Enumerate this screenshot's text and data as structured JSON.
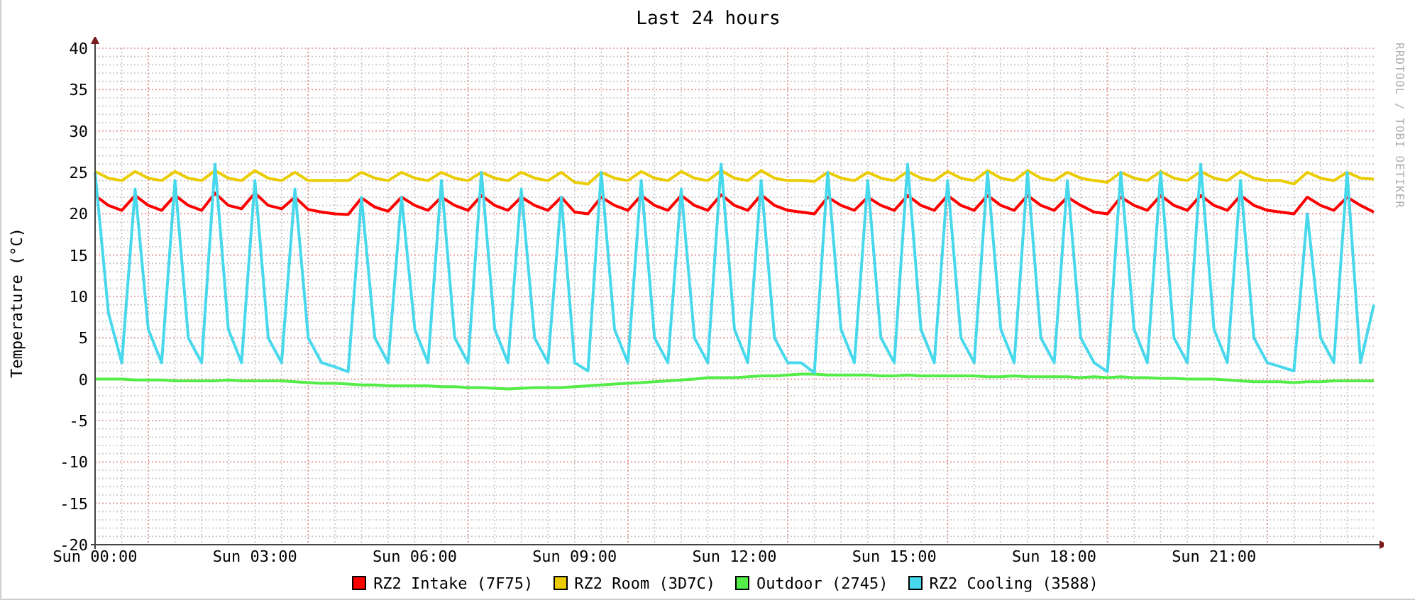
{
  "credit": "RRDTOOL / TOBI OETIKER",
  "chart_data": {
    "type": "line",
    "title": "Last 24 hours",
    "ylabel": "Temperature (°C)",
    "grid": true,
    "ylim": [
      -20,
      40
    ],
    "categories": [
      "Sun 00:00",
      null,
      null,
      null,
      null,
      null,
      null,
      null,
      null,
      null,
      null,
      null,
      "Sun 03:00",
      null,
      null,
      null,
      null,
      null,
      null,
      null,
      null,
      null,
      null,
      null,
      "Sun 06:00",
      null,
      null,
      null,
      null,
      null,
      null,
      null,
      null,
      null,
      null,
      null,
      "Sun 09:00",
      null,
      null,
      null,
      null,
      null,
      null,
      null,
      null,
      null,
      null,
      null,
      "Sun 12:00",
      null,
      null,
      null,
      null,
      null,
      null,
      null,
      null,
      null,
      null,
      null,
      "Sun 15:00",
      null,
      null,
      null,
      null,
      null,
      null,
      null,
      null,
      null,
      null,
      null,
      "Sun 18:00",
      null,
      null,
      null,
      null,
      null,
      null,
      null,
      null,
      null,
      null,
      null,
      "Sun 21:00",
      null,
      null,
      null,
      null,
      null,
      null,
      null,
      null,
      null,
      null,
      null,
      null
    ],
    "yticks": [
      -20,
      -15,
      -10,
      -5,
      0,
      5,
      10,
      15,
      20,
      25,
      30,
      35,
      40
    ],
    "series": [
      {
        "name": "RZ2 Intake (7F75)",
        "color": "#ff0000",
        "values": [
          22.2,
          21,
          20.4,
          22.2,
          21,
          20.4,
          22.2,
          21,
          20.4,
          22.5,
          21,
          20.6,
          22.5,
          21,
          20.6,
          22,
          20.5,
          20.2,
          20,
          19.9,
          21.9,
          20.8,
          20.3,
          22,
          21,
          20.4,
          22,
          21,
          20.4,
          22.2,
          21,
          20.4,
          22,
          21,
          20.4,
          22,
          20.2,
          20,
          22,
          21,
          20.4,
          22.2,
          21,
          20.4,
          22.2,
          21,
          20.4,
          22.3,
          21,
          20.4,
          22.3,
          21,
          20.4,
          20.2,
          20,
          22,
          21,
          20.4,
          22,
          21,
          20.4,
          22.2,
          21,
          20.4,
          22.2,
          21,
          20.4,
          22.2,
          21,
          20.4,
          22.2,
          21,
          20.4,
          22,
          21,
          20.2,
          20,
          22,
          21,
          20.4,
          22.2,
          21,
          20.4,
          22.2,
          21,
          20.4,
          22.2,
          21,
          20.4,
          20.2,
          20,
          22,
          21,
          20.4,
          22,
          21,
          20.2
        ]
      },
      {
        "name": "RZ2 Room (3D7C)",
        "color": "#eacc00",
        "values": [
          25.1,
          24.3,
          24,
          25.1,
          24.3,
          24,
          25.1,
          24.3,
          24,
          25.2,
          24.3,
          24,
          25.2,
          24.3,
          24,
          25,
          24,
          24,
          24,
          24,
          25,
          24.3,
          24,
          25,
          24.3,
          24,
          25,
          24.3,
          24,
          25,
          24.3,
          24,
          25,
          24.3,
          24,
          25,
          23.8,
          23.6,
          25,
          24.3,
          24,
          25.1,
          24.3,
          24,
          25.1,
          24.3,
          24,
          25.2,
          24.3,
          24,
          25.2,
          24.3,
          24,
          24,
          23.9,
          25,
          24.3,
          24,
          25,
          24.3,
          24,
          25.1,
          24.3,
          24,
          25.1,
          24.3,
          24,
          25.2,
          24.3,
          24,
          25.2,
          24.3,
          24,
          25,
          24.3,
          24,
          23.8,
          25,
          24.3,
          24,
          25.1,
          24.3,
          24,
          25.1,
          24.3,
          24,
          25.1,
          24.3,
          24,
          24,
          23.6,
          25,
          24.3,
          24,
          25,
          24.3,
          24.2
        ]
      },
      {
        "name": "Outdoor (2745)",
        "color": "#54ec48",
        "values": [
          0,
          0,
          0,
          -0.1,
          -0.1,
          -0.1,
          -0.2,
          -0.2,
          -0.2,
          -0.2,
          -0.1,
          -0.2,
          -0.2,
          -0.2,
          -0.2,
          -0.3,
          -0.4,
          -0.5,
          -0.5,
          -0.6,
          -0.7,
          -0.7,
          -0.8,
          -0.8,
          -0.8,
          -0.8,
          -0.9,
          -0.9,
          -1,
          -1,
          -1.1,
          -1.2,
          -1.1,
          -1,
          -1,
          -1,
          -0.9,
          -0.8,
          -0.7,
          -0.6,
          -0.5,
          -0.4,
          -0.3,
          -0.2,
          -0.1,
          0,
          0.2,
          0.2,
          0.2,
          0.3,
          0.4,
          0.4,
          0.5,
          0.6,
          0.6,
          0.5,
          0.5,
          0.5,
          0.5,
          0.4,
          0.4,
          0.5,
          0.4,
          0.4,
          0.4,
          0.4,
          0.4,
          0.3,
          0.3,
          0.4,
          0.3,
          0.3,
          0.3,
          0.3,
          0.2,
          0.3,
          0.2,
          0.3,
          0.2,
          0.2,
          0.1,
          0.1,
          0,
          0,
          0,
          -0.1,
          -0.2,
          -0.3,
          -0.3,
          -0.3,
          -0.4,
          -0.3,
          -0.3,
          -0.2,
          -0.2,
          -0.2,
          -0.2
        ]
      },
      {
        "name": "RZ2 Cooling (3588)",
        "color": "#48d8ec",
        "values": [
          25,
          8,
          2,
          23,
          6,
          2,
          24,
          5,
          2,
          26,
          6,
          2,
          24,
          5,
          2,
          23,
          5,
          2,
          1.5,
          0.9,
          22,
          5,
          2,
          22,
          6,
          2,
          24,
          5,
          2,
          25,
          6,
          2,
          23,
          5,
          2,
          22,
          2,
          1,
          25,
          6,
          2,
          24,
          5,
          2,
          23,
          5,
          2,
          26,
          6,
          2,
          24,
          5,
          2,
          2,
          0.8,
          25,
          6,
          2,
          24,
          5,
          2,
          26,
          6,
          2,
          24,
          5,
          2,
          25,
          6,
          2,
          25,
          5,
          2,
          24,
          5,
          2,
          0.9,
          25,
          6,
          2,
          25,
          5,
          2,
          26,
          6,
          2,
          24,
          5,
          2,
          1.5,
          1,
          20,
          5,
          2,
          25,
          2,
          9
        ]
      }
    ]
  }
}
